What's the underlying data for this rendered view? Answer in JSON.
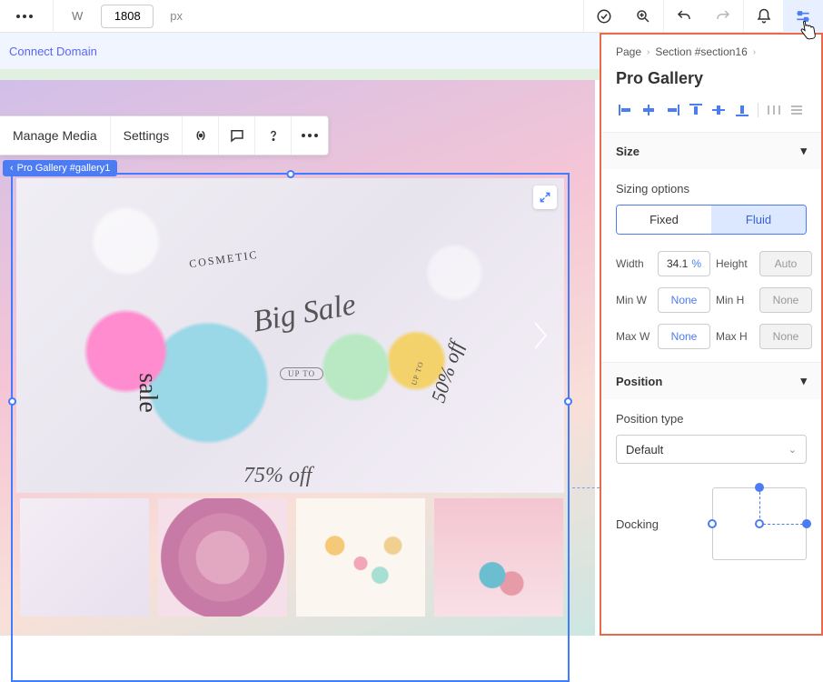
{
  "topbar": {
    "w_label": "W",
    "width_value": "1808",
    "px_label": "px"
  },
  "connect_bar": {
    "label": "Connect Domain"
  },
  "float_toolbar": {
    "manage_media": "Manage Media",
    "settings": "Settings"
  },
  "element_tag": "Pro Gallery #gallery1",
  "main_image_text": {
    "cosmetic": "COSMETIC",
    "big_sale": "Big Sale",
    "up_to": "UP TO",
    "sale": "sale",
    "fifty_off": "50% off",
    "up_to_2": "UP TO",
    "bottom": "75% off"
  },
  "panel": {
    "crumbs": {
      "page": "Page",
      "section": "Section #section16"
    },
    "title": "Pro Gallery",
    "size": {
      "header": "Size",
      "sizing_options_label": "Sizing options",
      "fixed": "Fixed",
      "fluid": "Fluid",
      "width_label": "Width",
      "width_value": "34.1",
      "width_unit": "%",
      "height_label": "Height",
      "height_value": "Auto",
      "minw_label": "Min W",
      "minw_value": "None",
      "minh_label": "Min H",
      "minh_value": "None",
      "maxw_label": "Max W",
      "maxw_value": "None",
      "maxh_label": "Max H",
      "maxh_value": "None"
    },
    "position": {
      "header": "Position",
      "type_label": "Position type",
      "type_value": "Default",
      "docking_label": "Docking"
    }
  }
}
